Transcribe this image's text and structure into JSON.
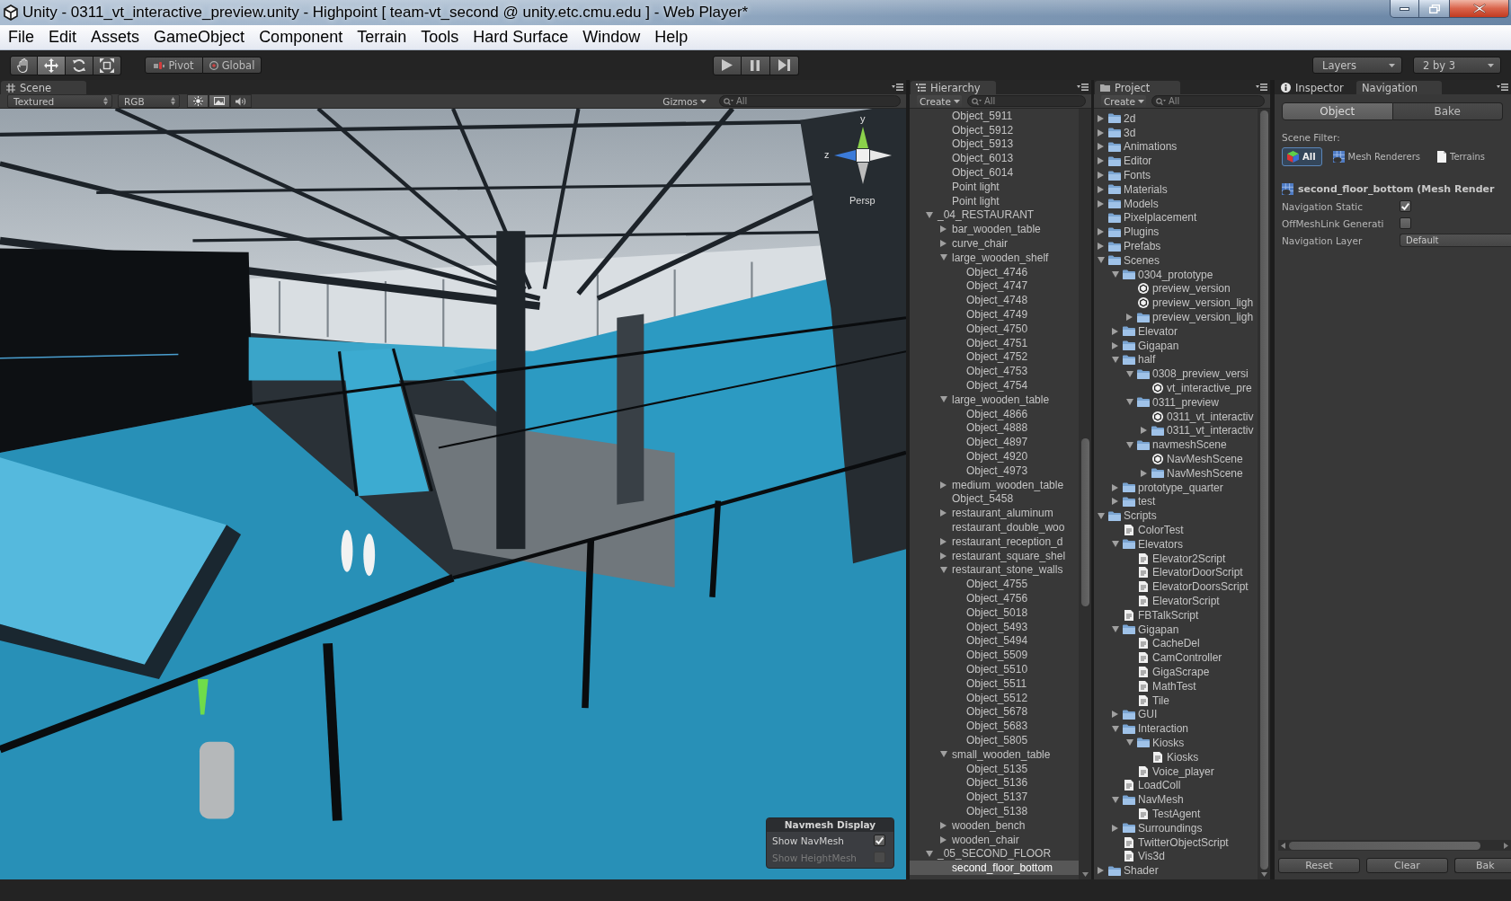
{
  "window": {
    "title": "Unity - 0311_vt_interactive_preview.unity - Highpoint [ team-vt_second @ unity.etc.cmu.edu ] - Web Player*"
  },
  "menu": [
    "File",
    "Edit",
    "Assets",
    "GameObject",
    "Component",
    "Terrain",
    "Tools",
    "Hard Surface",
    "Window",
    "Help"
  ],
  "toolbar": {
    "tools": [
      {
        "kind": "hand",
        "selected": false
      },
      {
        "kind": "move",
        "selected": true
      },
      {
        "kind": "rotate",
        "selected": false
      },
      {
        "kind": "scale",
        "selected": false
      }
    ],
    "pivot": "Pivot",
    "space": "Global",
    "layers": "Layers",
    "layout": "2 by 3"
  },
  "scene": {
    "tab": "Scene",
    "draw_mode": "Textured",
    "render_mode": "RGB",
    "toggles": [
      {
        "kind": "lighting",
        "on": true
      },
      {
        "kind": "image",
        "on": true
      },
      {
        "kind": "audio",
        "on": false
      }
    ],
    "gizmos": "Gizmos",
    "search": {
      "placeholder": "All"
    },
    "gizmo": {
      "axis_labels": [
        "y",
        "z"
      ],
      "projection": "Persp"
    },
    "navmesh_display": {
      "title": "Navmesh Display",
      "options": [
        {
          "label": "Show NavMesh",
          "checked": true,
          "disabled": false
        },
        {
          "label": "Show HeightMesh",
          "checked": false,
          "disabled": true
        }
      ]
    }
  },
  "hierarchy": {
    "tab": "Hierarchy",
    "create": "Create",
    "search": {
      "placeholder": "All"
    },
    "continued_items": [
      {
        "label": "Object_5911",
        "selected": false
      },
      {
        "label": "Object_5912",
        "selected": false
      },
      {
        "label": "Object_5913",
        "selected": false
      },
      {
        "label": "Object_6013",
        "selected": false
      },
      {
        "label": "Object_6014",
        "selected": false
      },
      {
        "label": "Point light",
        "selected": false
      },
      {
        "label": "Point light",
        "selected": false
      }
    ],
    "items": [
      {
        "label": "_04_RESTAURANT",
        "selected": false,
        "expanded": true,
        "children": [
          {
            "label": "bar_wooden_table",
            "selected": false,
            "expanded": false
          },
          {
            "label": "curve_chair",
            "selected": false,
            "expanded": false
          },
          {
            "label": "large_wooden_shelf",
            "selected": false,
            "expanded": true,
            "children": [
              {
                "label": "Object_4746",
                "selected": false
              },
              {
                "label": "Object_4747",
                "selected": false
              },
              {
                "label": "Object_4748",
                "selected": false
              },
              {
                "label": "Object_4749",
                "selected": false
              },
              {
                "label": "Object_4750",
                "selected": false
              },
              {
                "label": "Object_4751",
                "selected": false
              },
              {
                "label": "Object_4752",
                "selected": false
              },
              {
                "label": "Object_4753",
                "selected": false
              },
              {
                "label": "Object_4754",
                "selected": false
              }
            ]
          },
          {
            "label": "large_wooden_table",
            "selected": false,
            "expanded": true,
            "children": [
              {
                "label": "Object_4866",
                "selected": false
              },
              {
                "label": "Object_4888",
                "selected": false
              },
              {
                "label": "Object_4897",
                "selected": false
              },
              {
                "label": "Object_4920",
                "selected": false
              },
              {
                "label": "Object_4973",
                "selected": false
              }
            ]
          },
          {
            "label": "medium_wooden_table",
            "selected": false,
            "expanded": false
          },
          {
            "label": "Object_5458",
            "selected": false
          },
          {
            "label": "restaurant_aluminum",
            "selected": false,
            "expanded": false
          },
          {
            "label": "restaurant_double_woo",
            "selected": false
          },
          {
            "label": "restaurant_reception_d",
            "selected": false,
            "expanded": false
          },
          {
            "label": "restaurant_square_shel",
            "selected": false,
            "expanded": false
          },
          {
            "label": "restaurant_stone_walls",
            "selected": false,
            "expanded": true,
            "children": [
              {
                "label": "Object_4755",
                "selected": false
              },
              {
                "label": "Object_4756",
                "selected": false
              },
              {
                "label": "Object_5018",
                "selected": false
              },
              {
                "label": "Object_5493",
                "selected": false
              },
              {
                "label": "Object_5494",
                "selected": false
              },
              {
                "label": "Object_5509",
                "selected": false
              },
              {
                "label": "Object_5510",
                "selected": false
              },
              {
                "label": "Object_5511",
                "selected": false
              },
              {
                "label": "Object_5512",
                "selected": false
              },
              {
                "label": "Object_5678",
                "selected": false
              },
              {
                "label": "Object_5683",
                "selected": false
              },
              {
                "label": "Object_5805",
                "selected": false
              }
            ]
          },
          {
            "label": "small_wooden_table",
            "selected": false,
            "expanded": true,
            "children": [
              {
                "label": "Object_5135",
                "selected": false
              },
              {
                "label": "Object_5136",
                "selected": false
              },
              {
                "label": "Object_5137",
                "selected": false
              },
              {
                "label": "Object_5138",
                "selected": false
              }
            ]
          },
          {
            "label": "wooden_bench",
            "selected": false,
            "expanded": false
          },
          {
            "label": "wooden_chair",
            "selected": false,
            "expanded": false
          }
        ]
      },
      {
        "label": "_05_SECOND_FLOOR",
        "selected": false,
        "expanded": true,
        "children": [
          {
            "label": "second_floor_bottom",
            "selected": true
          }
        ]
      }
    ]
  },
  "project": {
    "tab": "Project",
    "create": "Create",
    "search": {
      "placeholder": "All"
    },
    "items": [
      {
        "label": "2d",
        "kind": "folder",
        "expanded": false
      },
      {
        "label": "3d",
        "kind": "folder",
        "expanded": false
      },
      {
        "label": "Animations",
        "kind": "folder",
        "expanded": false
      },
      {
        "label": "Editor",
        "kind": "folder",
        "expanded": false
      },
      {
        "label": "Fonts",
        "kind": "folder",
        "expanded": false
      },
      {
        "label": "Materials",
        "kind": "folder",
        "expanded": false
      },
      {
        "label": "Models",
        "kind": "folder",
        "expanded": false
      },
      {
        "label": "Pixelplacement",
        "kind": "folder"
      },
      {
        "label": "Plugins",
        "kind": "folder",
        "expanded": false
      },
      {
        "label": "Prefabs",
        "kind": "folder",
        "expanded": false
      },
      {
        "label": "Scenes",
        "kind": "folder",
        "expanded": true,
        "children": [
          {
            "label": "0304_prototype",
            "kind": "folder",
            "expanded": true,
            "children": [
              {
                "label": "preview_version",
                "kind": "scene"
              },
              {
                "label": "preview_version_ligh",
                "kind": "scene"
              },
              {
                "label": "preview_version_ligh",
                "kind": "folder",
                "expanded": false
              }
            ]
          },
          {
            "label": "Elevator",
            "kind": "folder",
            "expanded": false
          },
          {
            "label": "Gigapan",
            "kind": "folder",
            "expanded": false
          },
          {
            "label": "half",
            "kind": "folder",
            "expanded": true,
            "children": [
              {
                "label": "0308_preview_versi",
                "kind": "folder",
                "expanded": true,
                "children": [
                  {
                    "label": "vt_interactive_pre",
                    "kind": "scene"
                  }
                ]
              },
              {
                "label": "0311_preview",
                "kind": "folder",
                "expanded": true,
                "children": [
                  {
                    "label": "0311_vt_interactiv",
                    "kind": "scene"
                  },
                  {
                    "label": "0311_vt_interactiv",
                    "kind": "folder",
                    "expanded": false
                  }
                ]
              },
              {
                "label": "navmeshScene",
                "kind": "folder",
                "expanded": true,
                "children": [
                  {
                    "label": "NavMeshScene",
                    "kind": "scene"
                  },
                  {
                    "label": "NavMeshScene",
                    "kind": "folder",
                    "expanded": false
                  }
                ]
              }
            ]
          },
          {
            "label": "prototype_quarter",
            "kind": "folder",
            "expanded": false
          },
          {
            "label": "test",
            "kind": "folder",
            "expanded": false
          }
        ]
      },
      {
        "label": "Scripts",
        "kind": "folder",
        "expanded": true,
        "children": [
          {
            "label": "ColorTest",
            "kind": "script"
          },
          {
            "label": "Elevators",
            "kind": "folder",
            "expanded": true,
            "children": [
              {
                "label": "Elevator2Script",
                "kind": "script"
              },
              {
                "label": "ElevatorDoorScript",
                "kind": "script"
              },
              {
                "label": "ElevatorDoorsScript",
                "kind": "script"
              },
              {
                "label": "ElevatorScript",
                "kind": "script"
              }
            ]
          },
          {
            "label": "FBTalkScript",
            "kind": "script"
          },
          {
            "label": "Gigapan",
            "kind": "folder",
            "expanded": true,
            "children": [
              {
                "label": "CacheDel",
                "kind": "script"
              },
              {
                "label": "CamController",
                "kind": "script"
              },
              {
                "label": "GigaScrape",
                "kind": "script"
              },
              {
                "label": "MathTest",
                "kind": "script"
              },
              {
                "label": "Tile",
                "kind": "script"
              }
            ]
          },
          {
            "label": "GUI",
            "kind": "folder",
            "expanded": false
          },
          {
            "label": "Interaction",
            "kind": "folder",
            "expanded": true,
            "children": [
              {
                "label": "Kiosks",
                "kind": "folder",
                "expanded": true,
                "children": [
                  {
                    "label": "Kiosks",
                    "kind": "script"
                  }
                ]
              },
              {
                "label": "Voice_player",
                "kind": "script"
              }
            ]
          },
          {
            "label": "LoadColl",
            "kind": "script"
          },
          {
            "label": "NavMesh",
            "kind": "folder",
            "expanded": true,
            "children": [
              {
                "label": "TestAgent",
                "kind": "script"
              }
            ]
          },
          {
            "label": "Surroundings",
            "kind": "folder",
            "expanded": false
          },
          {
            "label": "TwitterObjectScript",
            "kind": "script"
          },
          {
            "label": "Vis3d",
            "kind": "script"
          }
        ]
      },
      {
        "label": "Shader",
        "kind": "folder",
        "expanded": false
      }
    ]
  },
  "inspector": {
    "tabs": [
      {
        "label": "Inspector",
        "kind": "inspector",
        "selected": false
      },
      {
        "label": "Navigation",
        "kind": "navigation",
        "selected": true
      }
    ],
    "modes": [
      {
        "label": "Object",
        "selected": true
      },
      {
        "label": "Bake",
        "selected": false
      }
    ],
    "scene_filter": {
      "label": "Scene Filter:",
      "options": [
        {
          "label": "All",
          "kind": "all",
          "selected": true
        },
        {
          "label": "Mesh Renderers",
          "kind": "mesh_renderers",
          "selected": false
        },
        {
          "label": "Terrains",
          "kind": "terrains",
          "selected": false
        }
      ]
    },
    "selected_object": "second_floor_bottom (Mesh Render",
    "properties": [
      {
        "label": "Navigation Static",
        "kind": "checkbox",
        "checked": true
      },
      {
        "label": "OffMeshLink Generati",
        "kind": "checkbox",
        "checked": false
      },
      {
        "label": "Navigation Layer",
        "kind": "dropdown",
        "value": "Default"
      }
    ],
    "buttons": [
      "Reset",
      "Clear",
      "Bak"
    ]
  }
}
